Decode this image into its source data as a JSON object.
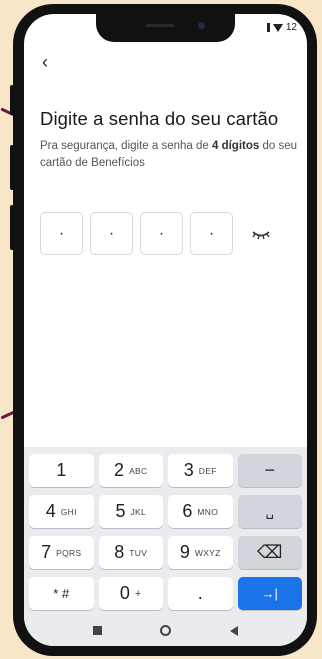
{
  "status_bar": {
    "time": "12"
  },
  "header": {
    "back_glyph": "‹"
  },
  "title": "Digite a senha do seu cartão",
  "subtitle": {
    "before": "Pra segurança, digite a senha de ",
    "bold": "4 dígitos",
    "after": " do seu cartão de Benefícios"
  },
  "pin": {
    "digits": [
      "·",
      "·",
      "·",
      "·"
    ]
  },
  "keyboard": {
    "keys": [
      {
        "main": "1",
        "sub": ""
      },
      {
        "main": "2",
        "sub": "ABC"
      },
      {
        "main": "3",
        "sub": "DEF"
      },
      {
        "main": "−",
        "sub": ""
      },
      {
        "main": "4",
        "sub": "GHI"
      },
      {
        "main": "5",
        "sub": "JKL"
      },
      {
        "main": "6",
        "sub": "MNO"
      },
      {
        "main": "␣",
        "sub": ""
      },
      {
        "main": "7",
        "sub": "PQRS"
      },
      {
        "main": "8",
        "sub": "TUV"
      },
      {
        "main": "9",
        "sub": "WXYZ"
      },
      {
        "main": "⌫",
        "sub": ""
      },
      {
        "main": "* #",
        "sub": ""
      },
      {
        "main": "0",
        "sub": "+"
      },
      {
        "main": ".",
        "sub": ""
      },
      {
        "main": "→|",
        "sub": ""
      }
    ]
  },
  "colors": {
    "accent": "#1a73e8",
    "background": "#f7e6c8",
    "decor": "#6b1a3a"
  }
}
